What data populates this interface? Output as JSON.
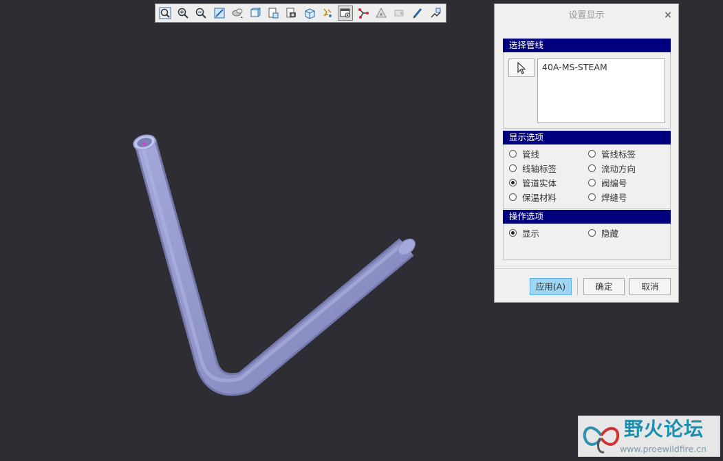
{
  "toolbar": {
    "buttons": [
      {
        "name": "refit-icon"
      },
      {
        "name": "zoom-in-icon"
      },
      {
        "name": "zoom-out-icon"
      },
      {
        "name": "repaint-icon"
      },
      {
        "name": "spin-center-icon"
      },
      {
        "name": "saved-orientations-icon"
      },
      {
        "name": "view-manager-icon"
      },
      {
        "name": "appearance-icon"
      },
      {
        "name": "display-style-icon"
      },
      {
        "name": "datum-display-icon"
      },
      {
        "name": "set-display-icon"
      },
      {
        "name": "pipe-network-icon"
      },
      {
        "name": "annotation-icon"
      },
      {
        "name": "tag-icon"
      },
      {
        "name": "sketch-icon"
      },
      {
        "name": "pipeline-icon"
      }
    ],
    "active_button": "set-display-icon"
  },
  "viewport": {
    "background": "#2e2d33",
    "pipe_color": "#8e93c6",
    "pipe_highlight": "#b3b7e6"
  },
  "dialog": {
    "title": "设置显示",
    "close_icon": "×",
    "select_pipeline": {
      "header": "选择管线",
      "items": [
        "40A-MS-STEAM"
      ]
    },
    "display_options": {
      "header": "显示选项",
      "options": [
        {
          "label": "管线",
          "checked": false
        },
        {
          "label": "管线标签",
          "checked": false
        },
        {
          "label": "线轴标签",
          "checked": false
        },
        {
          "label": "流动方向",
          "checked": false
        },
        {
          "label": "管道实体",
          "checked": true
        },
        {
          "label": "阀编号",
          "checked": false
        },
        {
          "label": "保温材料",
          "checked": false
        },
        {
          "label": "焊缝号",
          "checked": false
        }
      ]
    },
    "operation_options": {
      "header": "操作选项",
      "options": [
        {
          "label": "显示",
          "checked": true
        },
        {
          "label": "隐藏",
          "checked": false
        }
      ]
    },
    "buttons": {
      "apply": "应用(A)",
      "ok": "确定",
      "cancel": "取消"
    }
  },
  "watermark": {
    "title": "野火论坛",
    "url": "www.proewildfire.cn"
  }
}
